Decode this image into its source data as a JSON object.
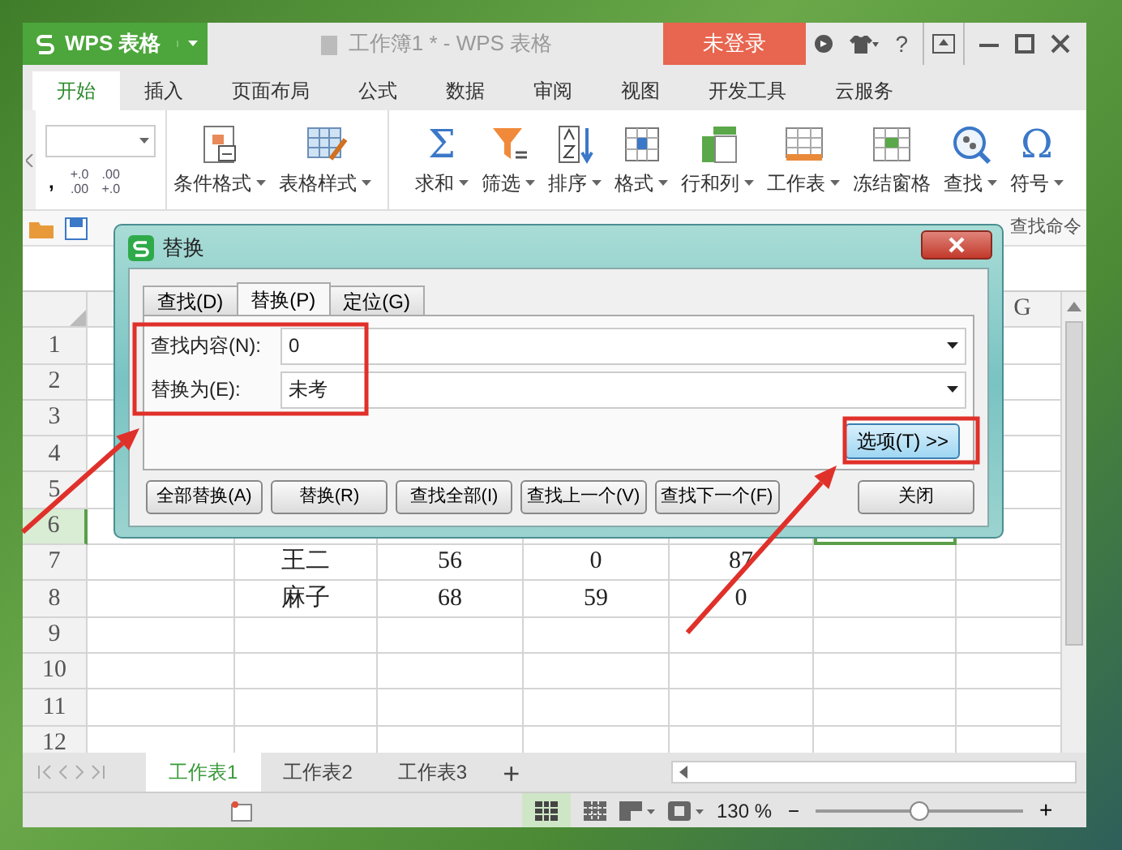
{
  "window": {
    "app_button": "WPS 表格",
    "title": "工作簿1 * - WPS 表格",
    "login_button": "未登录",
    "help_button": "?"
  },
  "menu_tabs": [
    {
      "label": "开始",
      "selected": true
    },
    {
      "label": "插入",
      "selected": false
    },
    {
      "label": "页面布局",
      "selected": false
    },
    {
      "label": "公式",
      "selected": false
    },
    {
      "label": "数据",
      "selected": false
    },
    {
      "label": "审阅",
      "selected": false
    },
    {
      "label": "视图",
      "selected": false
    },
    {
      "label": "开发工具",
      "selected": false
    },
    {
      "label": "云服务",
      "selected": false
    }
  ],
  "ribbon": {
    "comma": ",",
    "decimal_buttons": [
      {
        "top": "+.0",
        "bottom": ".00"
      },
      {
        "top": ".00",
        "bottom": "+.0"
      }
    ],
    "buttons": [
      {
        "kind": "conditional-format",
        "label": "条件格式",
        "dropdown": true
      },
      {
        "kind": "table-style",
        "label": "表格样式",
        "dropdown": true
      },
      {
        "kind": "glyph",
        "glyph": "Σ",
        "label": "求和",
        "dropdown": true
      },
      {
        "kind": "filter",
        "label": "筛选",
        "dropdown": true
      },
      {
        "kind": "sort",
        "label": "排序",
        "dropdown": true
      },
      {
        "kind": "format",
        "label": "格式",
        "dropdown": true
      },
      {
        "kind": "rows-columns",
        "label": "行和列",
        "dropdown": true
      },
      {
        "kind": "worksheet",
        "label": "工作表",
        "dropdown": true
      },
      {
        "kind": "freeze",
        "label": "冻结窗格",
        "dropdown": false
      },
      {
        "kind": "find",
        "label": "查找",
        "dropdown": true
      },
      {
        "kind": "glyph",
        "glyph": "Ω",
        "label": "符号",
        "dropdown": true
      }
    ]
  },
  "quick_access": {
    "search_label": "查找命令"
  },
  "sheet": {
    "column_header": "G",
    "rows": [
      {
        "number": "1",
        "selected": false
      },
      {
        "number": "2",
        "selected": false
      },
      {
        "number": "3",
        "selected": false
      },
      {
        "number": "4",
        "selected": false
      },
      {
        "number": "5",
        "selected": false
      },
      {
        "number": "6",
        "selected": true
      },
      {
        "number": "7",
        "selected": false,
        "cells": [
          "王二",
          "56",
          "0",
          "87"
        ]
      },
      {
        "number": "8",
        "selected": false,
        "cells": [
          "麻子",
          "68",
          "59",
          "0"
        ]
      },
      {
        "number": "9",
        "selected": false
      },
      {
        "number": "10",
        "selected": false
      },
      {
        "number": "11",
        "selected": false
      },
      {
        "number": "12",
        "selected": false
      }
    ]
  },
  "sheet_tabs": [
    {
      "label": "工作表1",
      "selected": true
    },
    {
      "label": "工作表2",
      "selected": false
    },
    {
      "label": "工作表3",
      "selected": false
    }
  ],
  "add_sheet": "+",
  "status_bar": {
    "zoom": "130 %",
    "zoom_out": "−",
    "zoom_in": "+",
    "zoom_slider": {
      "level": 0.5
    }
  },
  "dialog": {
    "title": "替换",
    "tabs": [
      {
        "label": "查找(D)",
        "selected": false
      },
      {
        "label": "替换(P)",
        "selected": true
      },
      {
        "label": "定位(G)",
        "selected": false
      }
    ],
    "fields": [
      {
        "label": "查找内容(N):",
        "value": "0"
      },
      {
        "label": "替换为(E):",
        "value": "未考"
      }
    ],
    "options_button": "选项(T) >>",
    "buttons": [
      "全部替换(A)",
      "替换(R)",
      "查找全部(I)",
      "查找上一个(V)",
      "查找下一个(F)",
      "关闭"
    ]
  },
  "annotations": [
    {
      "kind": "frame"
    },
    {
      "kind": "frame"
    },
    {
      "kind": "arrow"
    },
    {
      "kind": "arrow"
    }
  ]
}
